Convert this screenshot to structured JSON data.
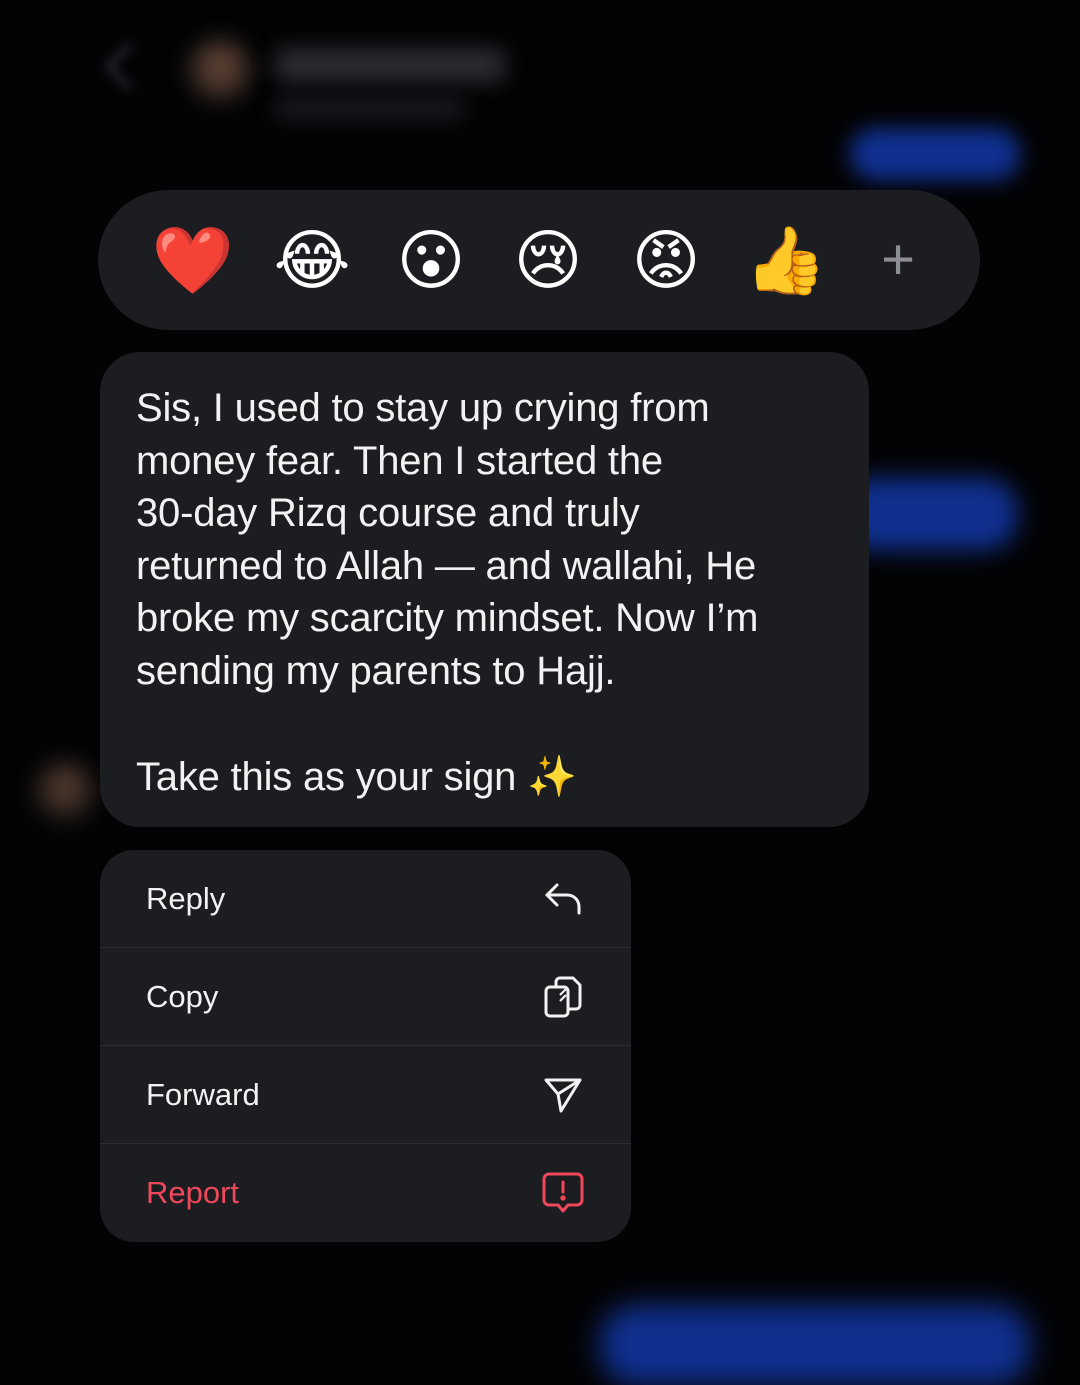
{
  "reactions": {
    "items": [
      {
        "name": "heart",
        "glyph": "❤️"
      },
      {
        "name": "laughing-tears",
        "glyph": "😂"
      },
      {
        "name": "surprised",
        "glyph": "😮"
      },
      {
        "name": "crying",
        "glyph": "😢"
      },
      {
        "name": "angry",
        "glyph": "😡"
      },
      {
        "name": "thumbs-up",
        "glyph": "👍"
      }
    ],
    "more_glyph": "+"
  },
  "message": {
    "lines": [
      "Sis, I used to stay up crying from",
      "money fear. Then I started the",
      "30-day Rizq course and truly",
      "returned to Allah — and wallahi, He",
      "broke my scarcity mindset. Now I’m",
      "sending my parents to Hajj."
    ],
    "closing": "Take this as your sign ✨"
  },
  "menu": {
    "reply": "Reply",
    "copy": "Copy",
    "forward": "Forward",
    "report": "Report"
  },
  "colors": {
    "background": "#030305",
    "surface": "#1c1d21",
    "text": "#f2f2f4",
    "danger": "#f0485a",
    "blurred_bubble": "#1238a8"
  },
  "icons": {
    "reply": "reply-arrow-icon",
    "copy": "copy-icon",
    "forward": "send-icon",
    "report": "report-icon"
  }
}
